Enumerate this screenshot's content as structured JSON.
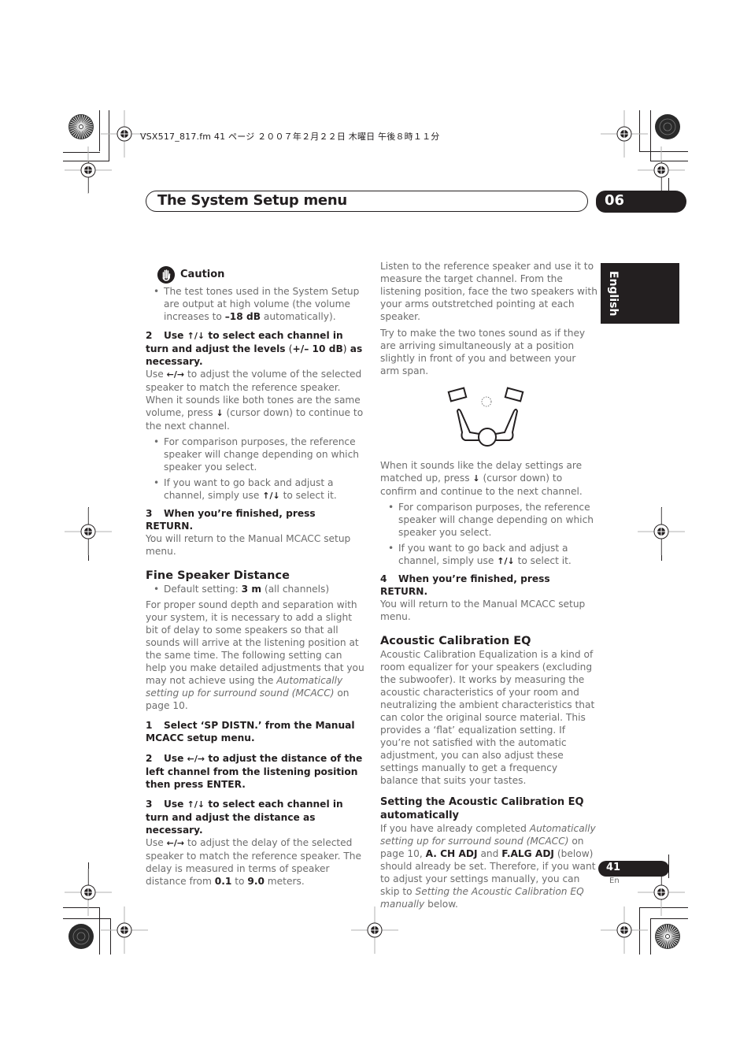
{
  "file_info": "VSX517_817.fm  41 ページ  ２００７年２月２２日  木曜日  午後８時１１分",
  "header": {
    "title": "The System Setup menu",
    "chapter": "06"
  },
  "language_tab": "English",
  "left_column": {
    "caution": {
      "label": "Caution",
      "bullet_prefix": "The test tones used in the System Setup are output at high volume (the volume increases to ",
      "bullet_bold": "–18 dB",
      "bullet_suffix": " automatically)."
    },
    "step2": {
      "num": "2",
      "heading_a": "Use ",
      "arrows_ud": "↑/↓",
      "heading_b": " to select each channel in turn and adjust the levels ",
      "heading_c": "(",
      "heading_d": "+/– 10 dB",
      "heading_e": ")",
      "heading_f": " as necessary.",
      "body_a": "Use ",
      "arrows_lr": "←/→",
      "body_b": " to adjust the volume of the selected speaker to match the reference speaker. When it sounds like both tones are the same volume, press ",
      "arrow_down": "↓",
      "body_c": " (cursor down) to continue to the next channel."
    },
    "bullets": [
      "For comparison purposes, the reference speaker will change depending on which speaker you select.",
      "If you want to go back and adjust a channel, simply use "
    ],
    "bullet2_suffix": " to select it.",
    "step3": {
      "num": "3",
      "heading": "When you’re finished, press RETURN.",
      "body": "You will return to the Manual MCACC setup menu."
    },
    "fine_speaker": {
      "title": "Fine Speaker Distance",
      "default_prefix": "Default setting: ",
      "default_bold": "3 m",
      "default_suffix": " (all channels)",
      "para_a": "For proper sound depth and separation with your system, it is necessary to add a slight bit of delay to some speakers so that all sounds will arrive at the listening position at the same time. The following setting can help you make detailed adjustments that you may not achieve using the ",
      "para_italic": "Automatically setting up for surround sound (MCACC)",
      "para_b": " on page 10.",
      "step1_num": "1",
      "step1": "Select ‘SP DISTN.’ from the Manual MCACC setup menu.",
      "step2_num": "2",
      "step2_a": "Use ",
      "step2_b": " to adjust the distance of the left channel from the listening position then press ENTER.",
      "step3_num": "3",
      "step3_a": "Use ",
      "step3_b": " to select each channel in turn and adjust the distance as necessary.",
      "body_a": "Use ",
      "body_b": " to adjust the delay of the selected speaker to match the reference speaker. The delay is measured in terms of speaker distance from ",
      "min": "0.1",
      "body_c": " to ",
      "max": "9.0",
      "body_d": " meters."
    }
  },
  "right_column": {
    "para1": "Listen to the reference speaker and use it to measure the target channel. From the listening position, face the two speakers with your arms outstretched pointing at each speaker.",
    "para2": "Try to make the two tones sound as if they are arriving simultaneously at a position slightly in front of you and between your arm span.",
    "para3_a": "When it sounds like the delay settings are matched up, press ",
    "para3_b": " (cursor down) to confirm and continue to the next channel.",
    "bullets": [
      "For comparison purposes, the reference speaker will change depending on which speaker you select.",
      "If you want to go back and adjust a channel, simply use "
    ],
    "bullet2_suffix": " to select it.",
    "step4": {
      "num": "4",
      "heading": "When you’re finished, press RETURN.",
      "body": "You will return to the Manual MCACC setup menu."
    },
    "ace": {
      "title": "Acoustic Calibration EQ",
      "body": "Acoustic Calibration Equalization is a kind of room equalizer for your speakers (excluding the subwoofer). It works by measuring the acoustic characteristics of your room and neutralizing the ambient characteristics that can color the original source material. This provides a ‘flat’ equalization setting. If you’re not satisfied with the automatic adjustment, you can also adjust these settings manually to get a frequency balance that suits your tastes."
    },
    "ace_auto": {
      "title": "Setting the Acoustic Calibration EQ automatically",
      "a": "If you have already completed ",
      "italic1": "Automatically setting up for surround sound (MCACC)",
      "b": " on page 10, ",
      "bold1": "A. CH ADJ",
      "c": " and ",
      "bold2": "F.ALG ADJ",
      "d": " (below) should already be set. Therefore, if you want to adjust your settings manually, you can skip to ",
      "italic2": "Setting the Acoustic Calibration EQ manually",
      "e": " below."
    }
  },
  "footer": {
    "page_number": "41",
    "lang_code": "En"
  }
}
